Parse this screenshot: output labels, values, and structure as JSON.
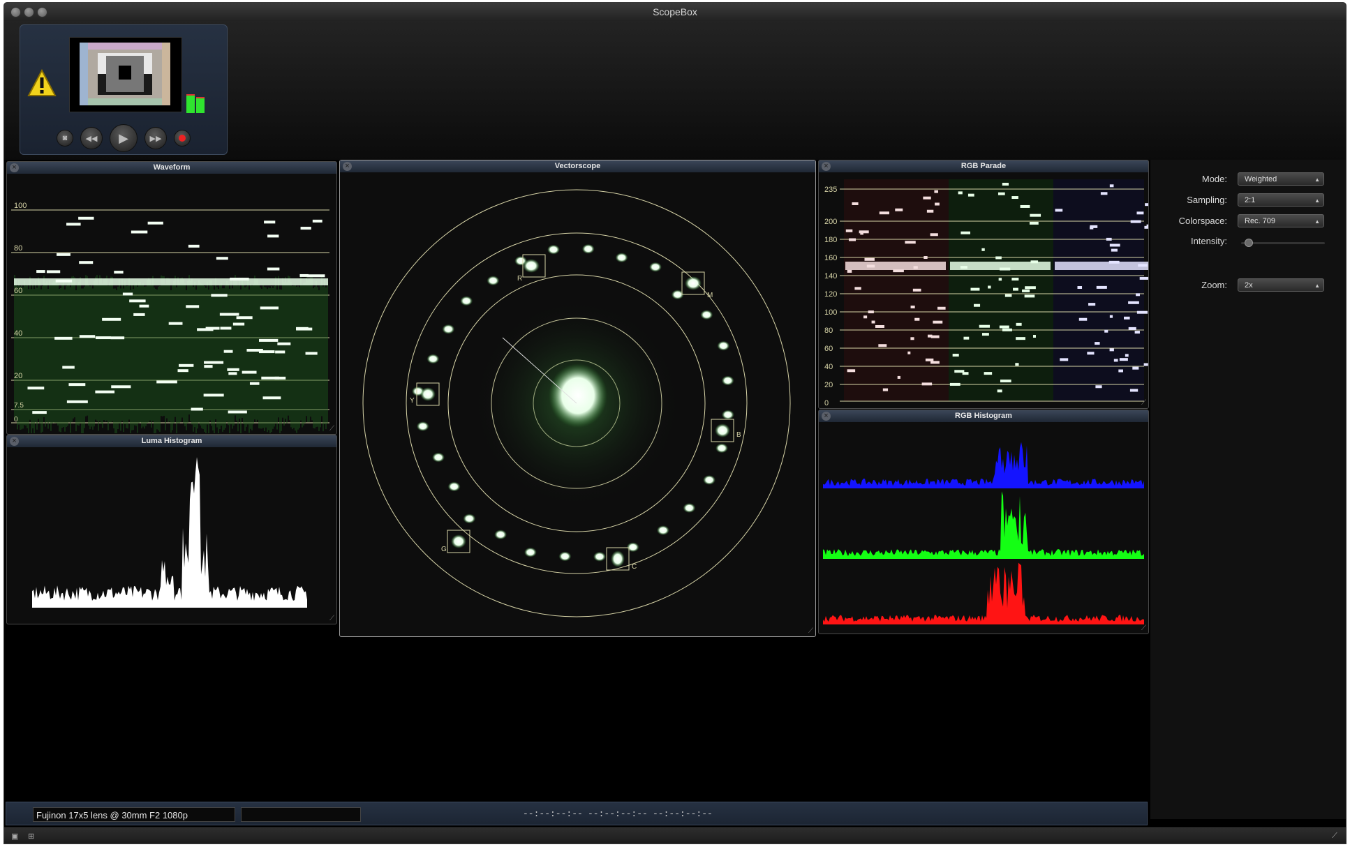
{
  "window": {
    "title": "ScopeBox"
  },
  "transport": {
    "warning_icon": "warning-icon",
    "buttons": [
      "camera-icon",
      "rewind-icon",
      "play-icon",
      "fast-forward-icon",
      "record-icon"
    ]
  },
  "panels": {
    "waveform": {
      "title": "Waveform",
      "scale": [
        "100",
        "80",
        "60",
        "40",
        "20",
        "7.5",
        "0"
      ]
    },
    "luma_histogram": {
      "title": "Luma Histogram"
    },
    "vectorscope": {
      "title": "Vectorscope",
      "targets": [
        "R",
        "M",
        "B",
        "C",
        "G",
        "Y"
      ]
    },
    "rgb_parade": {
      "title": "RGB Parade",
      "scale": [
        "235",
        "200",
        "180",
        "160",
        "140",
        "120",
        "100",
        "80",
        "60",
        "40",
        "20",
        "0"
      ]
    },
    "rgb_histogram": {
      "title": "RGB Histogram"
    }
  },
  "sidebar": {
    "mode": {
      "label": "Mode:",
      "value": "Weighted"
    },
    "sampling": {
      "label": "Sampling:",
      "value": "2:1"
    },
    "colorspace": {
      "label": "Colorspace:",
      "value": "Rec. 709"
    },
    "intensity": {
      "label": "Intensity:",
      "level": 0.05
    },
    "zoom": {
      "label": "Zoom:",
      "value": "2x"
    }
  },
  "status": {
    "lens_text": "Fujinon 17x5 lens @ 30mm F2 1080p",
    "timecodes": [
      "--:--:--:--",
      "--:--:--:--",
      "--:--:--:--"
    ]
  },
  "colors": {
    "accent": "#3d4a5e",
    "graticule": "#d8d5a8",
    "trace": "#3bd13b"
  }
}
